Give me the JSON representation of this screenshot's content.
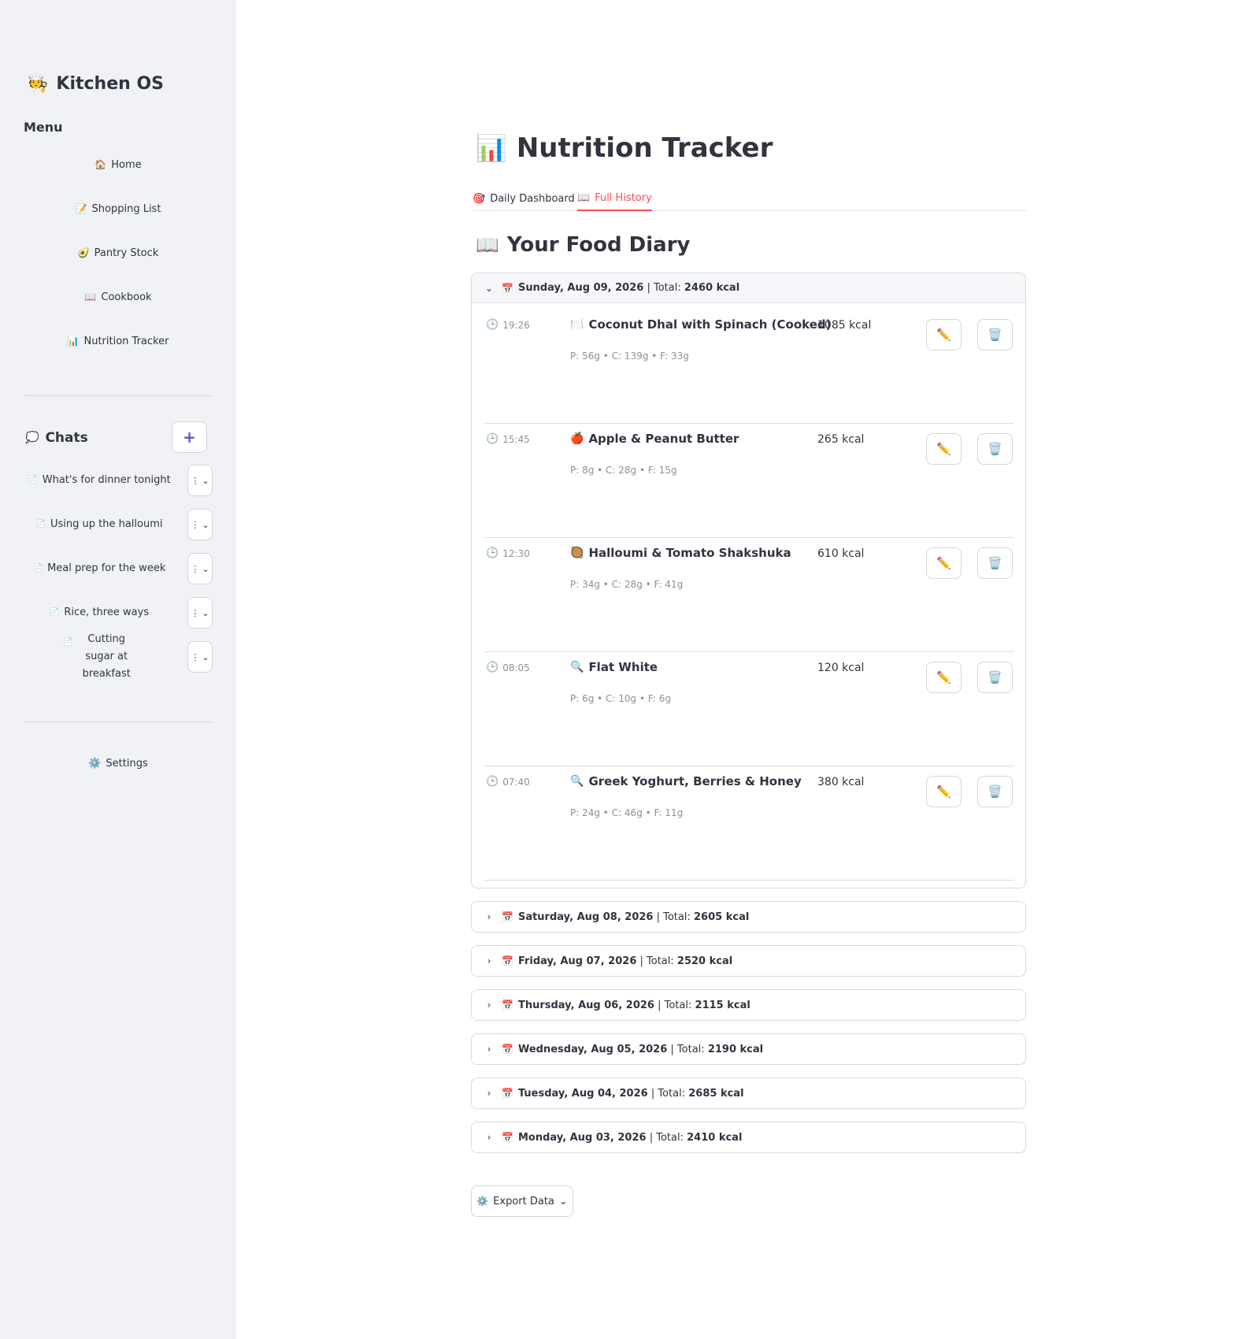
{
  "sidebar": {
    "brand": {
      "emoji": "🧑‍🍳",
      "title": "Kitchen OS"
    },
    "menu_title": "Menu",
    "nav": [
      {
        "icon": "🏠",
        "label": "Home"
      },
      {
        "icon": "📝",
        "label": "Shopping List"
      },
      {
        "icon": "🥑",
        "label": "Pantry Stock"
      },
      {
        "icon": "📖",
        "label": "Cookbook"
      },
      {
        "icon": "📊",
        "label": "Nutrition Tracker"
      }
    ],
    "chats_icon": "💭",
    "chats_title": "Chats",
    "new_chat_icon": "+",
    "chat_menu_icon": "⋮",
    "chat_menu_chevron": "⌄",
    "chat_icon": "📄",
    "chats": [
      {
        "label": "What's for dinner tonight"
      },
      {
        "label": "Using up the halloumi"
      },
      {
        "label": "Meal prep for the week"
      },
      {
        "label": "Rice, three ways"
      },
      {
        "label": "Cutting sugar at breakfast"
      }
    ],
    "settings": {
      "icon": "⚙️",
      "label": "Settings"
    }
  },
  "main": {
    "title_emoji": "📊",
    "title": "Nutrition Tracker",
    "tabs": [
      {
        "icon": "🎯",
        "label": "Daily Dashboard",
        "active": false
      },
      {
        "icon": "📖",
        "label": "Full History",
        "active": true
      }
    ],
    "section_emoji": "📖",
    "section_title": "Your Food Diary",
    "total_label": "| Total:",
    "calendar_icon": "📅",
    "days": [
      {
        "date": "Sunday, Aug 09, 2026",
        "total": "2460 kcal",
        "open": true,
        "entries": [
          {
            "time": "19:26",
            "icon": "🍽️",
            "name": "Coconut Dhal with Spinach (Cooked)",
            "kcal": "1085 kcal",
            "macros": "P: 56g • C: 139g • F: 33g"
          },
          {
            "time": "15:45",
            "icon": "🍎",
            "name": "Apple & Peanut Butter",
            "kcal": "265 kcal",
            "macros": "P: 8g • C: 28g • F: 15g"
          },
          {
            "time": "12:30",
            "icon": "🥘",
            "name": "Halloumi & Tomato Shakshuka",
            "kcal": "610 kcal",
            "macros": "P: 34g • C: 28g • F: 41g"
          },
          {
            "time": "08:05",
            "icon": "🔍",
            "name": "Flat White",
            "kcal": "120 kcal",
            "macros": "P: 6g • C: 10g • F: 6g"
          },
          {
            "time": "07:40",
            "icon": "🔍",
            "name": "Greek Yoghurt, Berries & Honey",
            "kcal": "380 kcal",
            "macros": "P: 24g • C: 46g • F: 11g"
          }
        ]
      },
      {
        "date": "Saturday, Aug 08, 2026",
        "total": "2605 kcal",
        "open": false
      },
      {
        "date": "Friday, Aug 07, 2026",
        "total": "2520 kcal",
        "open": false
      },
      {
        "date": "Thursday, Aug 06, 2026",
        "total": "2115 kcal",
        "open": false
      },
      {
        "date": "Wednesday, Aug 05, 2026",
        "total": "2190 kcal",
        "open": false
      },
      {
        "date": "Tuesday, Aug 04, 2026",
        "total": "2685 kcal",
        "open": false
      },
      {
        "date": "Monday, Aug 03, 2026",
        "total": "2410 kcal",
        "open": false
      }
    ],
    "export": {
      "icon": "⚙️",
      "label": "Export Data",
      "chevron": "⌄"
    },
    "icons": {
      "clock": "🕒",
      "edit": "✏️",
      "delete": "🗑️",
      "chevron_open": "⌄",
      "chevron_closed": "›"
    },
    "colors": {
      "accent": "#ff4b4b",
      "edit": "#e8692b",
      "sidebar_bg": "#f0f2f6"
    }
  }
}
